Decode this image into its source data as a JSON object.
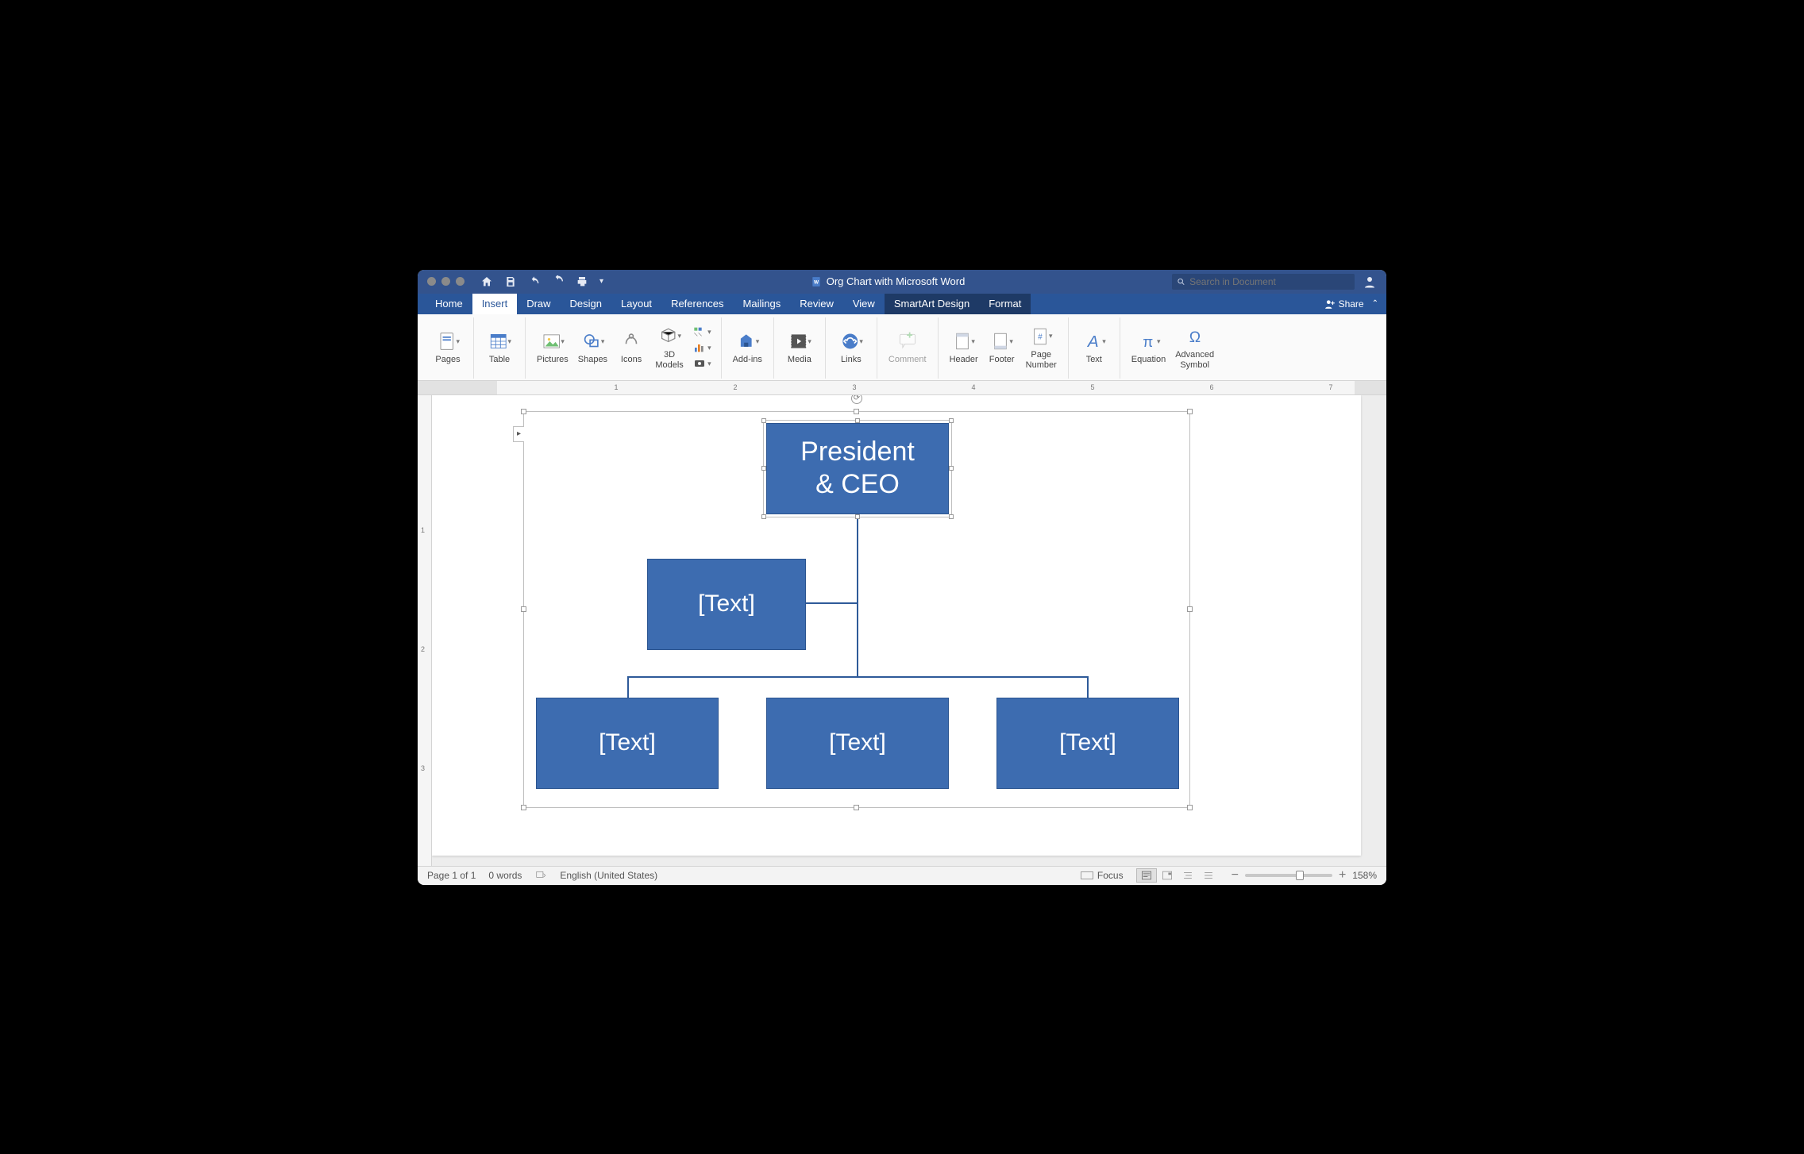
{
  "titlebar": {
    "doc_title": "Org Chart with Microsoft Word",
    "search_placeholder": "Search in Document"
  },
  "tabs": {
    "home": "Home",
    "insert": "Insert",
    "draw": "Draw",
    "design": "Design",
    "layout": "Layout",
    "references": "References",
    "mailings": "Mailings",
    "review": "Review",
    "view": "View",
    "smartart": "SmartArt Design",
    "format": "Format",
    "share": "Share"
  },
  "ribbon": {
    "pages": "Pages",
    "table": "Table",
    "pictures": "Pictures",
    "shapes": "Shapes",
    "icons": "Icons",
    "models": "3D\nModels",
    "addins": "Add-ins",
    "media": "Media",
    "links": "Links",
    "comment": "Comment",
    "header": "Header",
    "footer": "Footer",
    "pagenum": "Page\nNumber",
    "text": "Text",
    "equation": "Equation",
    "symbol": "Advanced\nSymbol"
  },
  "ruler": {
    "nums": [
      "1",
      "2",
      "3",
      "4",
      "5",
      "6",
      "7"
    ],
    "vnums": [
      "1",
      "2",
      "3"
    ]
  },
  "chart_data": {
    "type": "org-chart",
    "root": {
      "label": "President\n& CEO",
      "selected": true
    },
    "assistant": {
      "label": "[Text]"
    },
    "children": [
      {
        "label": "[Text]"
      },
      {
        "label": "[Text]"
      },
      {
        "label": "[Text]"
      }
    ]
  },
  "status": {
    "page": "Page 1 of 1",
    "words": "0 words",
    "lang": "English (United States)",
    "focus": "Focus",
    "zoom": "158%"
  }
}
